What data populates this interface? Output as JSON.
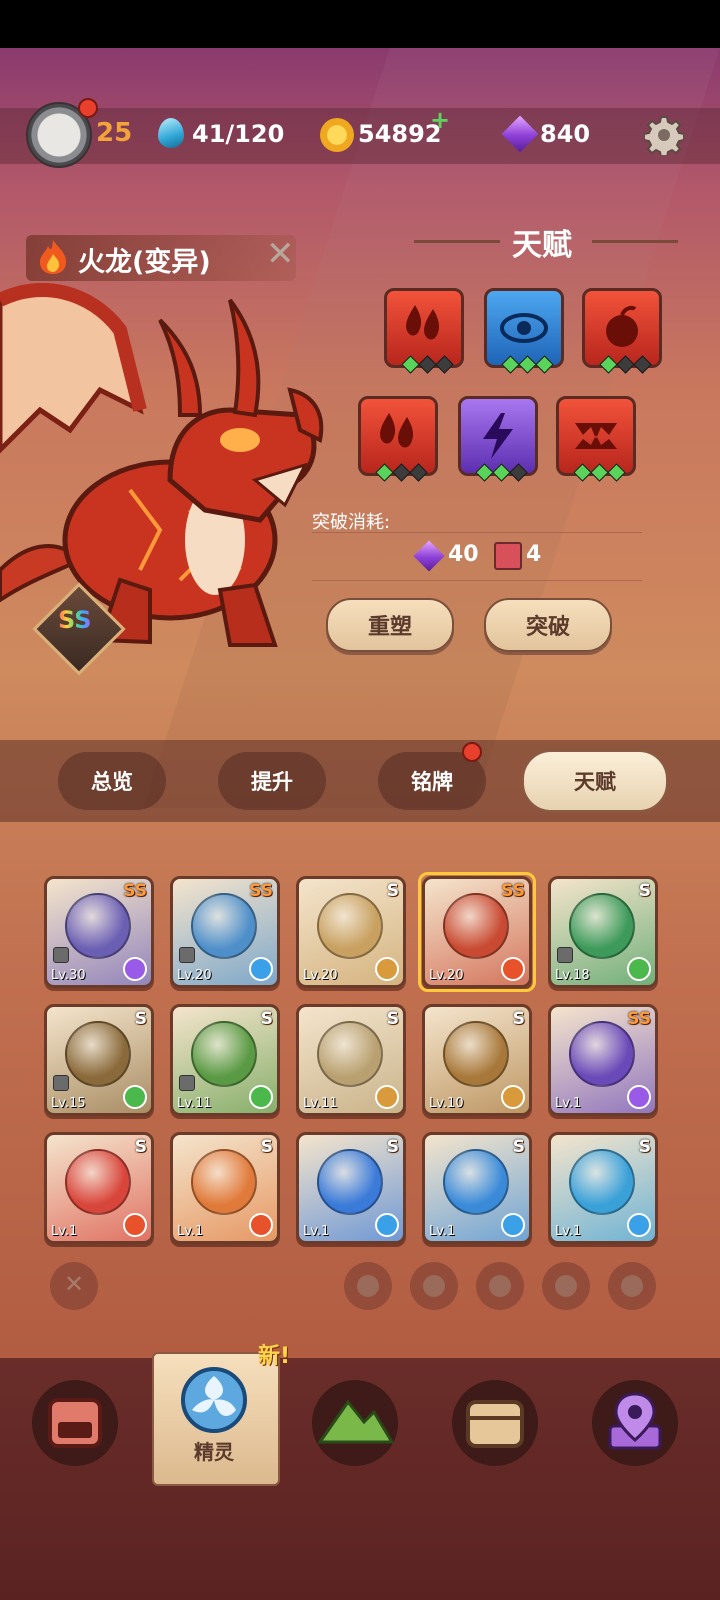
{
  "player": {
    "level": "25"
  },
  "resources": {
    "energy": "41/120",
    "gold": "54892",
    "gold_plus": "+",
    "gems": "840"
  },
  "pet": {
    "name": "火龙(变异)",
    "rank": "SS"
  },
  "talent": {
    "title": "天赋",
    "tiles": [
      {
        "icon": "fire-drops-icon",
        "color": "red",
        "pips": [
          1,
          0,
          0
        ]
      },
      {
        "icon": "eye-icon",
        "color": "blue",
        "pips": [
          1,
          1,
          1
        ]
      },
      {
        "icon": "fruit-icon",
        "color": "red",
        "pips": [
          1,
          0,
          0
        ]
      },
      {
        "icon": "fire-drops-icon",
        "color": "red",
        "pips": [
          1,
          0,
          0
        ]
      },
      {
        "icon": "lightning-icon",
        "color": "purple",
        "pips": [
          1,
          1,
          0
        ]
      },
      {
        "icon": "fangs-icon",
        "color": "red",
        "pips": [
          1,
          1,
          1
        ]
      }
    ],
    "cost_label": "突破消耗:",
    "cost_gems": "40",
    "cost_books": "4",
    "reshape_button": "重塑",
    "breakthrough_button": "突破"
  },
  "tabs": [
    "总览",
    "提升",
    "铭牌",
    "天赋"
  ],
  "pets": [
    {
      "rank": "SS",
      "level": "Lv.30",
      "element": "lightning",
      "locked": true,
      "color": "#6b5fb3"
    },
    {
      "rank": "SS",
      "level": "Lv.20",
      "element": "ice",
      "locked": true,
      "color": "#4f8fc9"
    },
    {
      "rank": "S",
      "level": "Lv.20",
      "element": "earth",
      "locked": false,
      "color": "#c8a060"
    },
    {
      "rank": "SS",
      "level": "Lv.20",
      "element": "fire",
      "locked": false,
      "color": "#c84a32"
    },
    {
      "rank": "S",
      "level": "Lv.18",
      "element": "grass",
      "locked": true,
      "color": "#3d9a5a"
    },
    {
      "rank": "S",
      "level": "Lv.15",
      "element": "grass",
      "locked": true,
      "color": "#8a6a3a"
    },
    {
      "rank": "S",
      "level": "Lv.11",
      "element": "grass",
      "locked": true,
      "color": "#5a9a44"
    },
    {
      "rank": "S",
      "level": "Lv.11",
      "element": "earth",
      "locked": false,
      "color": "#b8a070"
    },
    {
      "rank": "S",
      "level": "Lv.10",
      "element": "earth",
      "locked": false,
      "color": "#a8783a"
    },
    {
      "rank": "SS",
      "level": "Lv.1",
      "element": "lightning",
      "locked": false,
      "color": "#6a4ab8"
    },
    {
      "rank": "S",
      "level": "Lv.1",
      "element": "fire",
      "locked": false,
      "color": "#d8453a"
    },
    {
      "rank": "S",
      "level": "Lv.1",
      "element": "fire",
      "locked": false,
      "color": "#e07a3a"
    },
    {
      "rank": "S",
      "level": "Lv.1",
      "element": "ice",
      "locked": false,
      "color": "#3a7ad8"
    },
    {
      "rank": "S",
      "level": "Lv.1",
      "element": "ice",
      "locked": false,
      "color": "#3a8ad8"
    },
    {
      "rank": "S",
      "level": "Lv.1",
      "element": "ice",
      "locked": false,
      "color": "#3aa0d8"
    }
  ],
  "element_colors": {
    "fire": "#e8522a",
    "ice": "#3aa0e8",
    "grass": "#4ab84a",
    "earth": "#d89a3a",
    "lightning": "#9a5ae8"
  },
  "filters": [
    "close-filter-icon",
    "fire-filter-icon",
    "ice-filter-icon",
    "grass-filter-icon",
    "earth-filter-icon",
    "lightning-filter-icon"
  ],
  "nav": {
    "new_badge": "新!",
    "selected_label": "精灵"
  }
}
